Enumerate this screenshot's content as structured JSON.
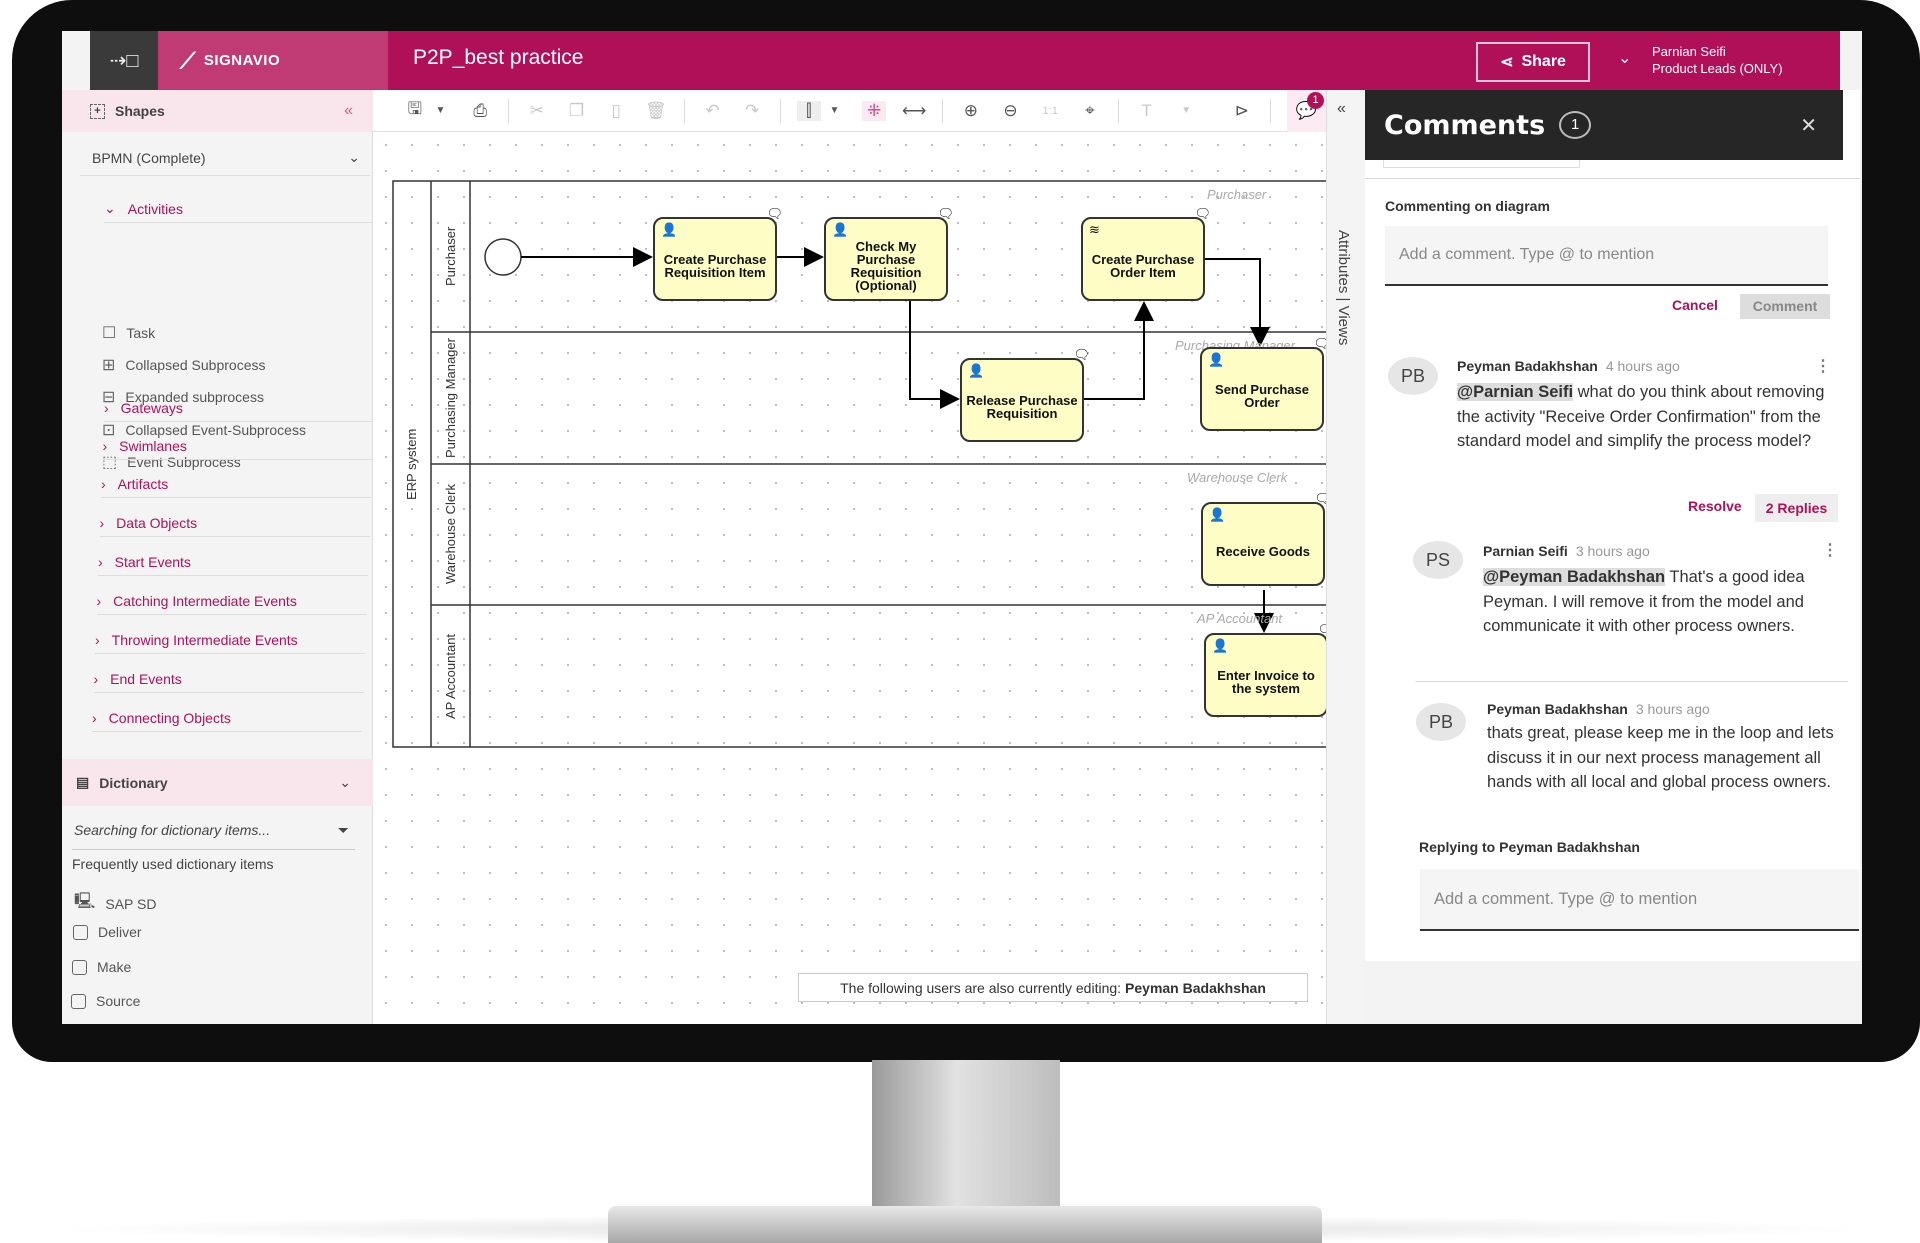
{
  "header": {
    "app_title": "SIGNAVIO",
    "diagram_title": "P2P_best practice",
    "share_label": "Share",
    "user_name": "Parnian Seifi",
    "user_org": "Product Leads (ONLY)",
    "brand_color": "#b01058"
  },
  "sidebar": {
    "shapes_label": "Shapes",
    "collapse_icon": "«",
    "stencil_set": "BPMN (Complete)",
    "activities_label": "Activities",
    "activities": [
      "Task",
      "Collapsed Subprocess",
      "Expanded subprocess",
      "Collapsed Event-Subprocess",
      "Event Subprocess"
    ],
    "groups": [
      "Gateways",
      "Swimlanes",
      "Artifacts",
      "Data Objects",
      "Start Events",
      "Catching Intermediate Events",
      "Throwing Intermediate Events",
      "End Events",
      "Connecting Objects"
    ],
    "dictionary_label": "Dictionary",
    "dictionary_search_placeholder": "Searching for dictionary items...",
    "frequent_label": "Frequently used dictionary items",
    "dictionary_items": [
      "SAP SD",
      "Deliver",
      "Make",
      "Source"
    ]
  },
  "toolbar": {
    "comments_badge": "1"
  },
  "right_tabs": {
    "label": "Attributes | Views"
  },
  "diagram": {
    "pool": "ERP system",
    "lanes": [
      "Purchaser",
      "Purchasing Manager",
      "Warehouse Clerk",
      "AP Accountant"
    ],
    "lane_ghosts": [
      "Purchaser",
      "Purchasing Manager",
      "Warehouse Clerk",
      "AP Accountant"
    ],
    "tasks": [
      "Create Purchase Requisition Item",
      "Check My Purchase Requisition (Optional)",
      "Create Purchase Order Item",
      "Release Purchase Requisition",
      "Send Purchase Order",
      "Receive Goods",
      "Enter Invoice to the system"
    ]
  },
  "status": {
    "prefix": "The following users are also currently editing:",
    "user": "Peyman Badakhshan"
  },
  "comments": {
    "title": "Comments",
    "count": "1",
    "commenting_on": "Commenting on diagram",
    "input_placeholder": "Add a comment. Type @ to mention",
    "cancel": "Cancel",
    "comment": "Comment",
    "resolve": "Resolve",
    "replies": "2 Replies",
    "thread": [
      {
        "initials": "PB",
        "author": "Peyman Badakhshan",
        "time": "4 hours ago",
        "mention": "@Parnian Seifi",
        "text": " what do you think about removing the activity \"Receive Order Confirmation\" from the standard model and simplify the process model?"
      },
      {
        "initials": "PS",
        "author": "Parnian Seifi",
        "time": "3 hours ago",
        "mention": "@Peyman Badakhshan",
        "text": " That's a good idea Peyman. I will remove it from the model and communicate it with other process owners."
      },
      {
        "initials": "PB",
        "author": "Peyman Badakhshan",
        "time": "3 hours ago",
        "mention": "",
        "text": "thats great, please keep me in the loop and lets discuss it in our next process management all hands with all local and global process owners."
      }
    ],
    "replying_to": "Replying to Peyman Badakhshan",
    "reply_placeholder": "Add a comment. Type @ to mention"
  }
}
